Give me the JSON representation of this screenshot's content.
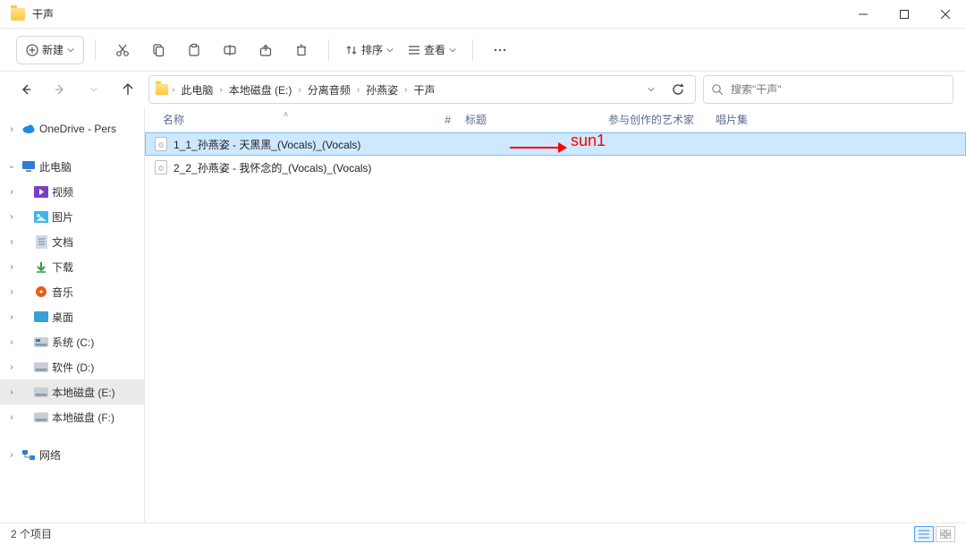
{
  "window": {
    "title": "干声"
  },
  "toolbar": {
    "new_label": "新建",
    "sort_label": "排序",
    "view_label": "查看"
  },
  "breadcrumb": [
    "此电脑",
    "本地磁盘 (E:)",
    "分离音频",
    "孙燕姿",
    "干声"
  ],
  "search": {
    "placeholder": "搜索\"干声\""
  },
  "sidebar": {
    "onedrive": "OneDrive - Pers",
    "thispc": "此电脑",
    "items": [
      {
        "label": "视频",
        "icon": "video"
      },
      {
        "label": "图片",
        "icon": "pictures"
      },
      {
        "label": "文档",
        "icon": "documents"
      },
      {
        "label": "下载",
        "icon": "downloads"
      },
      {
        "label": "音乐",
        "icon": "music"
      },
      {
        "label": "桌面",
        "icon": "desktop"
      },
      {
        "label": "系统 (C:)",
        "icon": "drive"
      },
      {
        "label": "软件 (D:)",
        "icon": "drive"
      },
      {
        "label": "本地磁盘 (E:)",
        "icon": "drive"
      },
      {
        "label": "本地磁盘 (F:)",
        "icon": "drive"
      }
    ],
    "network": "网络"
  },
  "columns": {
    "name": "名称",
    "num": "#",
    "title": "标题",
    "artist": "参与创作的艺术家",
    "album": "唱片集"
  },
  "files": [
    {
      "name": "1_1_孙燕姿 - 天黑黑_(Vocals)_(Vocals)",
      "selected": true
    },
    {
      "name": "2_2_孙燕姿 - 我怀念的_(Vocals)_(Vocals)",
      "selected": false
    }
  ],
  "annotation": {
    "label": "sun1"
  },
  "status": {
    "text": "2 个项目"
  }
}
